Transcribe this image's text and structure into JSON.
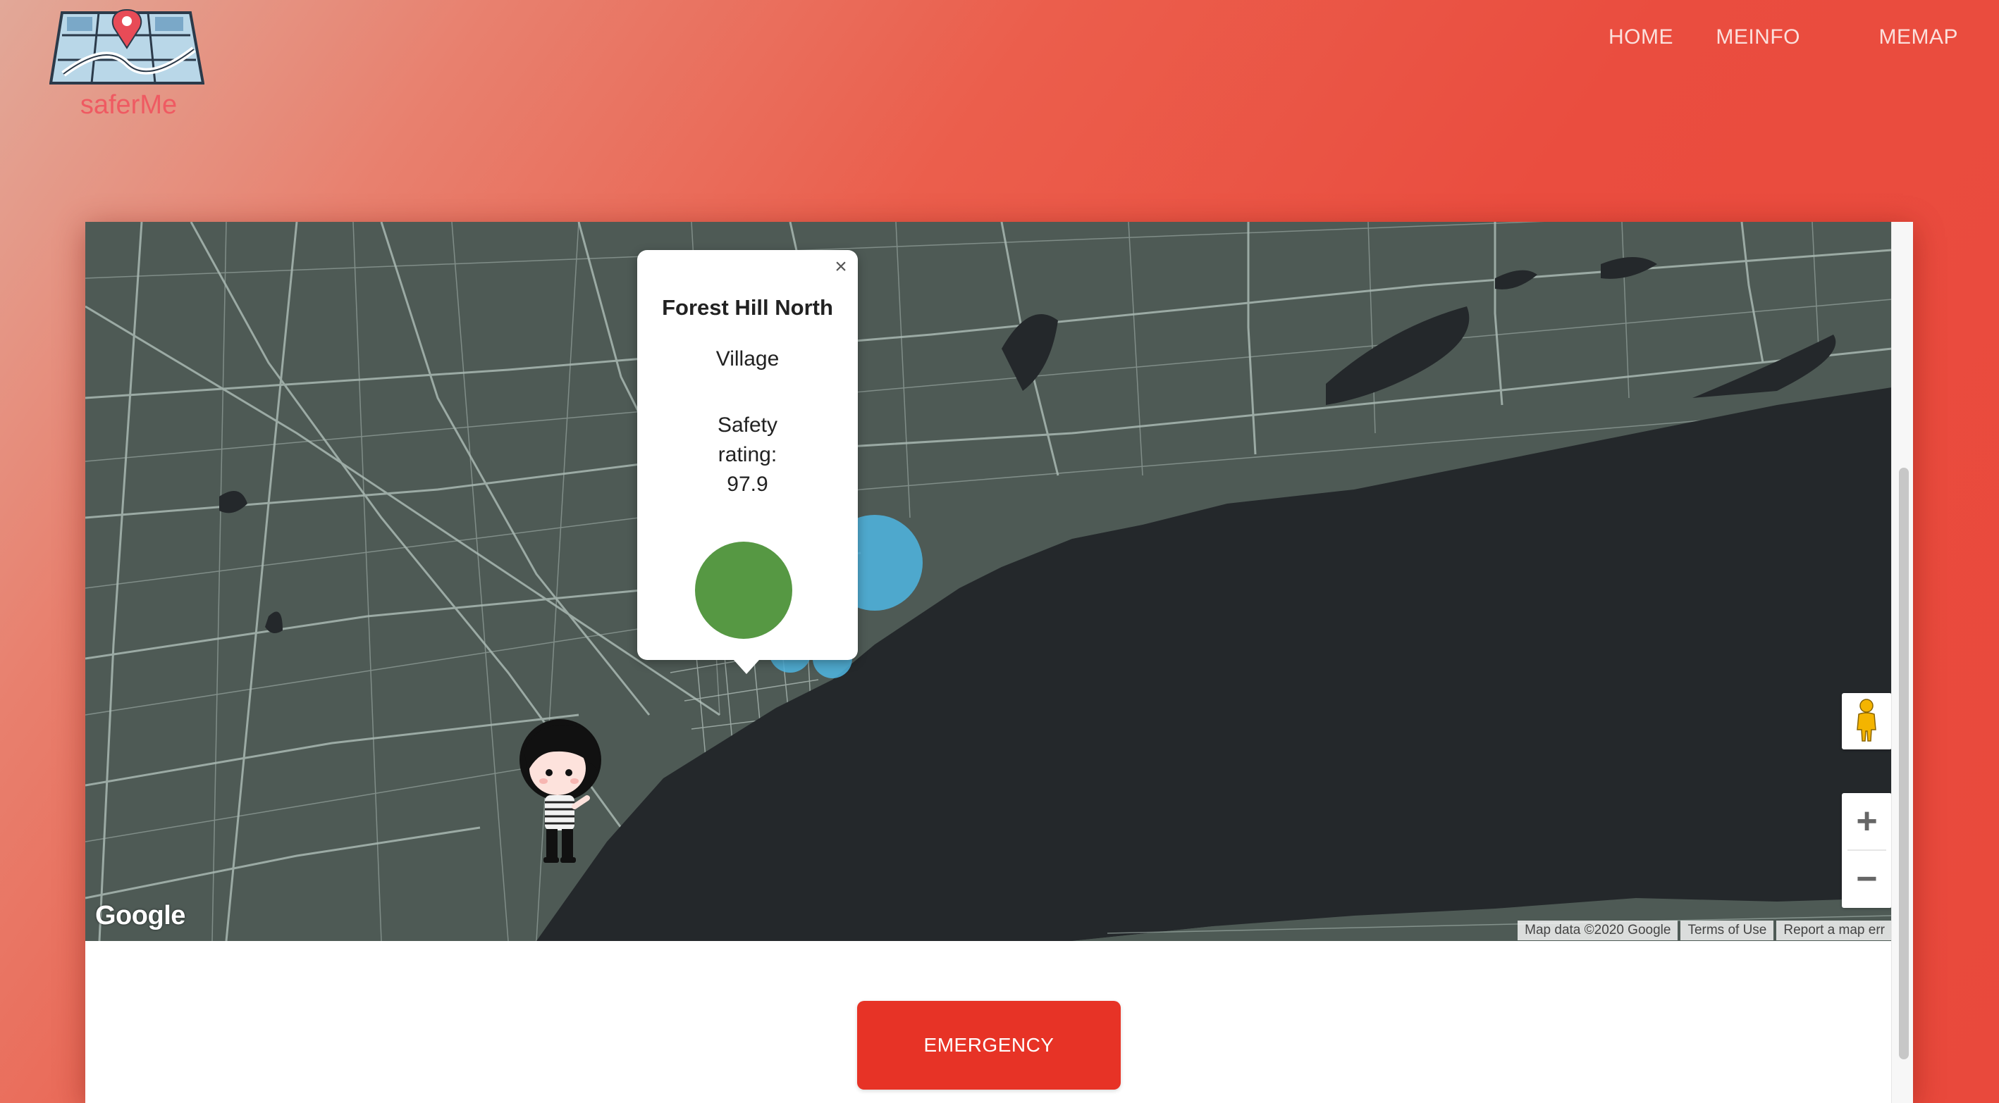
{
  "app": {
    "brand": "saferMe"
  },
  "nav": {
    "items": [
      {
        "label": "HOME"
      },
      {
        "label": "MEINFO"
      },
      {
        "label": "MEMAP"
      }
    ]
  },
  "map": {
    "popup": {
      "title": "Forest Hill North",
      "type": "Village",
      "rating_line1": "Safety",
      "rating_line2": "rating:",
      "rating_value": "97.9",
      "close_symbol": "×",
      "status_color": "#569843"
    },
    "google_logo": "Google",
    "attribution": {
      "map_data": "Map data ©2020 Google",
      "terms": "Terms of Use",
      "report": "Report a map err"
    },
    "controls": {
      "zoom_in": "+",
      "zoom_out": "−",
      "street_view_icon": "pegman-icon"
    },
    "colors": {
      "land": "#4e5a55",
      "water": "#24282b",
      "roads": "#a9b8b2",
      "heat": "#4fb6e3"
    }
  },
  "actions": {
    "emergency_label": "EMERGENCY"
  }
}
